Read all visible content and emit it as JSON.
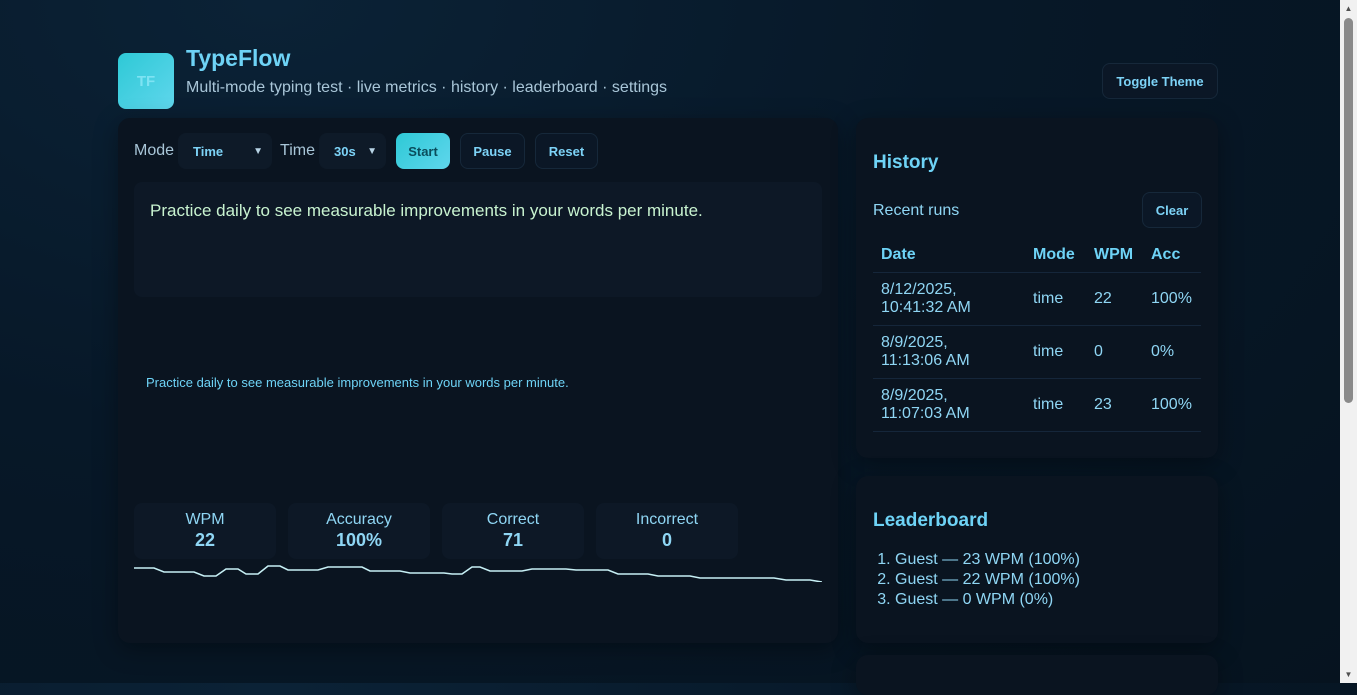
{
  "header": {
    "logo_text": "TF",
    "title": "TypeFlow",
    "subtitle": "Multi-mode typing test · live metrics · history · leaderboard · settings",
    "toggle_theme_label": "Toggle Theme"
  },
  "controls": {
    "mode_label": "Mode",
    "mode_value": "Time",
    "time_label": "Time",
    "time_value": "30s",
    "start_label": "Start",
    "pause_label": "Pause",
    "reset_label": "Reset"
  },
  "test": {
    "target_text": "Practice daily to see measurable improvements in your words per minute.",
    "typed_echo": "Practice daily to see measurable improvements in your words per minute."
  },
  "stats": [
    {
      "label": "WPM",
      "value": "22"
    },
    {
      "label": "Accuracy",
      "value": "100%"
    },
    {
      "label": "Correct",
      "value": "71"
    },
    {
      "label": "Incorrect",
      "value": "0"
    }
  ],
  "history": {
    "title": "History",
    "recent_label": "Recent runs",
    "clear_label": "Clear",
    "columns": [
      "Date",
      "Mode",
      "WPM",
      "Acc"
    ],
    "rows": [
      {
        "date_line1": "8/12/2025,",
        "date_line2": "10:41:32 AM",
        "mode": "time",
        "wpm": "22",
        "acc": "100%"
      },
      {
        "date_line1": "8/9/2025,",
        "date_line2": "11:13:06 AM",
        "mode": "time",
        "wpm": "0",
        "acc": "0%"
      },
      {
        "date_line1": "8/9/2025,",
        "date_line2": "11:07:03 AM",
        "mode": "time",
        "wpm": "23",
        "acc": "100%"
      }
    ]
  },
  "leaderboard": {
    "title": "Leaderboard",
    "entries": [
      "Guest — 23 WPM (100%)",
      "Guest — 22 WPM (100%)",
      "Guest — 0 WPM (0%)"
    ]
  },
  "colors": {
    "accent": "#6ed3f6",
    "accent_gradient_start": "#2ec9d6",
    "accent_gradient_end": "#5fd6ec",
    "correct_text": "#c8f3d0",
    "sparkline": "#c7f0f5"
  },
  "icons": {
    "select_chevron": "chevron-down-icon",
    "scroll_up": "scroll-up-arrow-icon",
    "scroll_down": "scroll-down-arrow-icon"
  }
}
